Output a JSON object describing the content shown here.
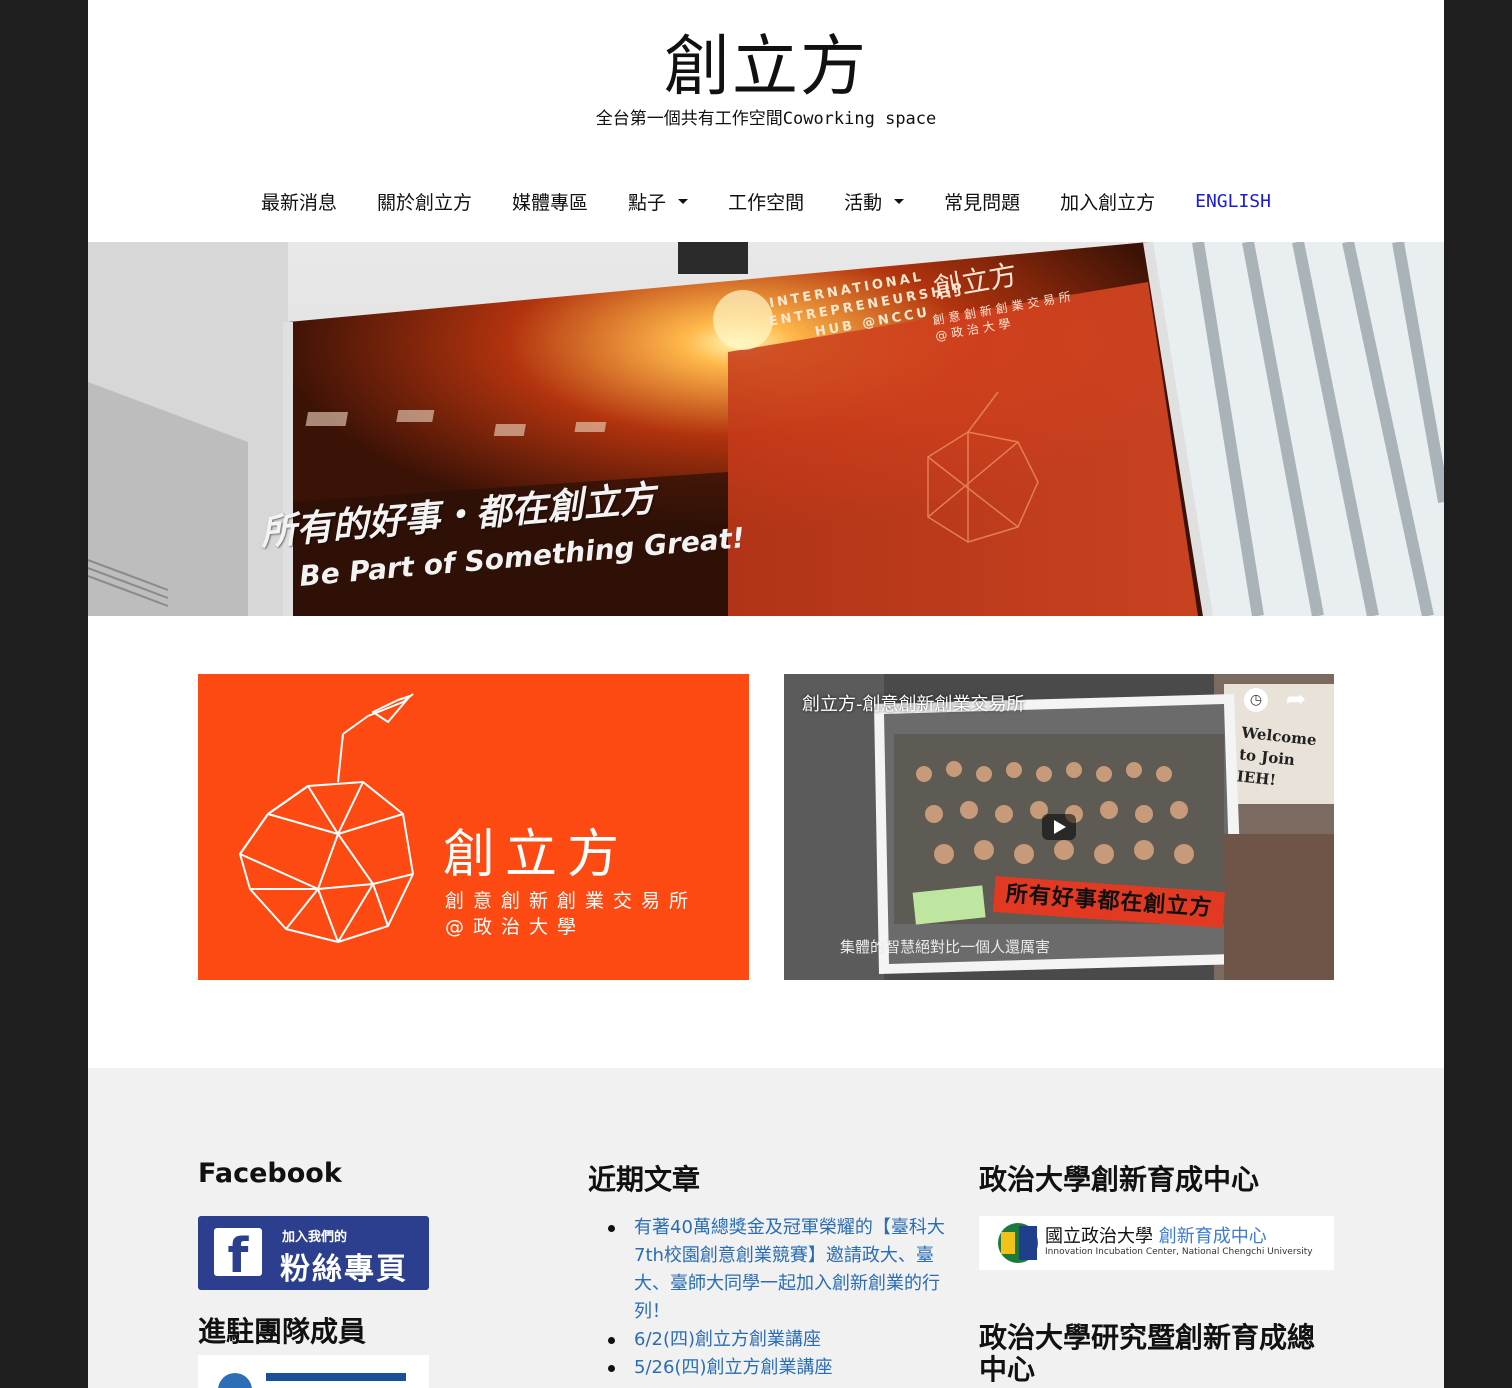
{
  "site": {
    "title": "創立方",
    "description": "全台第一個共有工作空間Coworking space"
  },
  "nav": {
    "items": [
      {
        "label": "最新消息",
        "dropdown": false
      },
      {
        "label": "關於創立方",
        "dropdown": false
      },
      {
        "label": "媒體專區",
        "dropdown": false
      },
      {
        "label": "點子",
        "dropdown": true
      },
      {
        "label": "工作空間",
        "dropdown": false
      },
      {
        "label": "活動",
        "dropdown": true
      },
      {
        "label": "常見問題",
        "dropdown": false
      },
      {
        "label": "加入創立方",
        "dropdown": false
      },
      {
        "label": "ENGLISH",
        "dropdown": false
      }
    ]
  },
  "hero": {
    "sign_en": "INTERNATIONAL ENTREPRENEURSHIP HUB @NCCU",
    "sign_zh": "創立方",
    "sign_zh_sub1": "創意創新創業交易所",
    "sign_zh_sub2": "@政治大學",
    "slogan_zh": "所有的好事・都在創立方",
    "slogan_en": "Be Part of Something Great!"
  },
  "promo": {
    "brand_title": "創立方",
    "brand_sub1": "創意創新創業交易所",
    "brand_sub2": "@政治大學"
  },
  "video": {
    "title": "創立方-創意創新創業交易所",
    "caption": "集體的智慧絕對比一個人還厲害",
    "banner": "所有好事都在創立方",
    "welcome": "Welcome to Join IEH!"
  },
  "footer": {
    "facebook": {
      "title": "Facebook",
      "badge_small": "加入我們的",
      "badge_big": "粉絲專頁"
    },
    "members": {
      "title": "進駐團隊成員"
    },
    "recent": {
      "title": "近期文章",
      "posts": [
        "有著40萬總獎金及冠軍榮耀的【臺科大7th校園創意創業競賽】邀請政大、臺大、臺師大同學一起加入創新創業的行列！",
        "6/2(四)創立方創業講座",
        "5/26(四)創立方創業講座"
      ]
    },
    "incubation": {
      "title": "政治大學創新育成中心",
      "card_zh_black": "國立政治大學",
      "card_zh_blue": "創新育成中心",
      "card_en": "Innovation Incubation Center, National Chengchi University"
    },
    "research": {
      "title": "政治大學研究暨創新育成總中心"
    }
  },
  "colors": {
    "brand_orange": "#fd4a12",
    "link_blue": "#2a6db3",
    "english_link": "#1a1adb",
    "facebook_blue": "#2c3f8e",
    "footer_bg": "#f1f1f1"
  }
}
